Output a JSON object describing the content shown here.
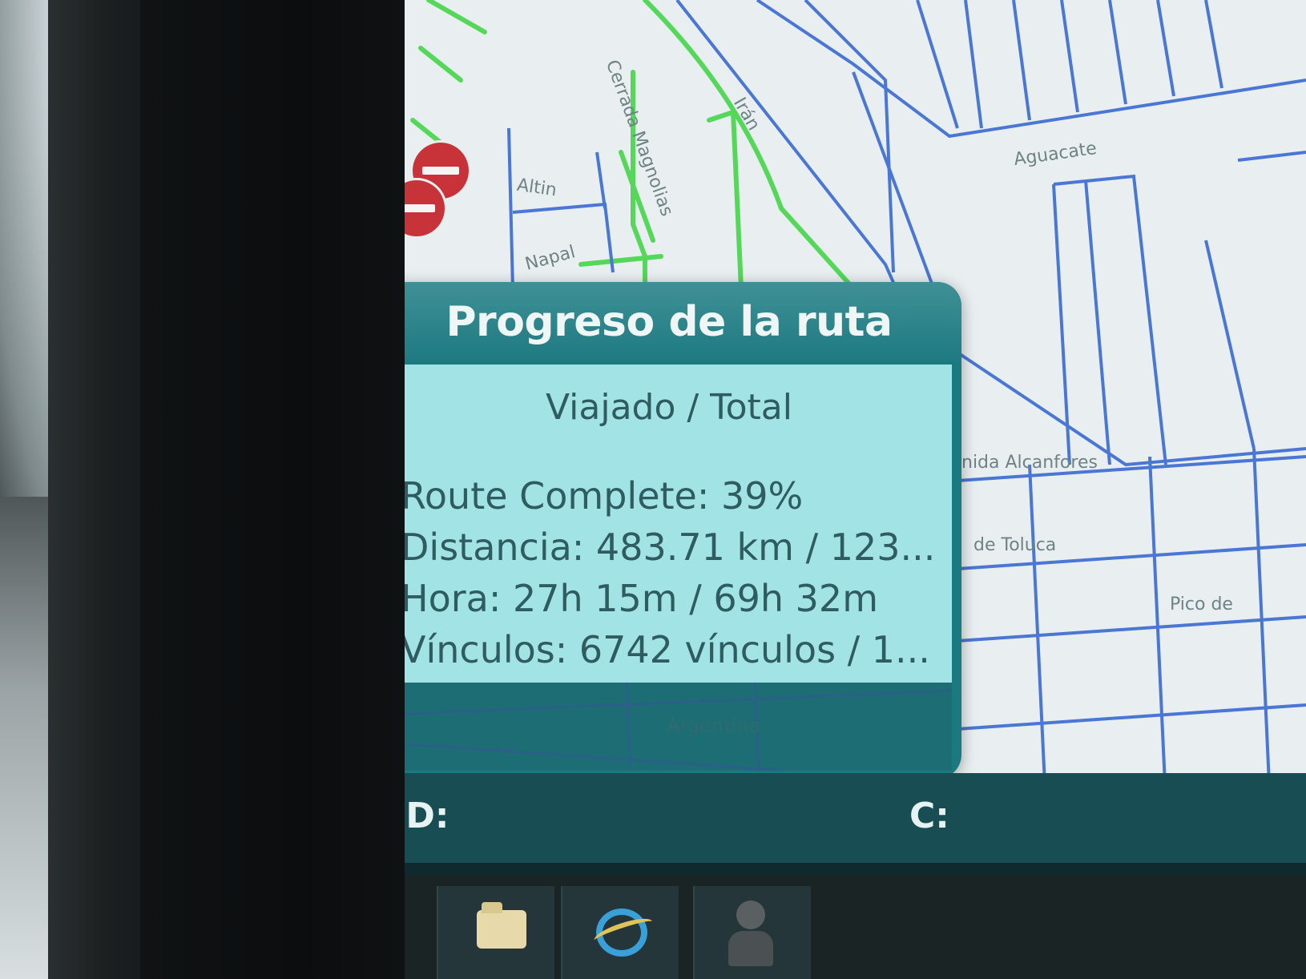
{
  "map": {
    "street_labels": [
      "Altin",
      "Napal",
      "Cerrada Magnolias",
      "Irán",
      "Aguacate",
      "nida Alcanfores",
      "de Toluca",
      "Pico de",
      "Argentina"
    ]
  },
  "dialog": {
    "title": "Progreso de la ruta",
    "subtitle": "Viajado / Total",
    "lines": [
      "Route Complete: 39%",
      "Distancia: 483.71 km / 123...",
      "Hora: 27h 15m / 69h 32m",
      "Vínculos: 6742 vínculos / 1..."
    ],
    "route_complete_percent": 39
  },
  "statusbar": {
    "id_label": "ID:",
    "c_label": "C:"
  },
  "taskbar": {
    "icons": [
      "folder-icon",
      "internet-explorer-icon",
      "person-icon"
    ]
  },
  "colors": {
    "dialog_header": "#1e7a81",
    "dialog_body": "#a2e4e6",
    "map_background": "#e9eff0",
    "road_blue": "#4a76d4",
    "road_green": "#55d85a",
    "no_entry_red": "#c8333a"
  }
}
